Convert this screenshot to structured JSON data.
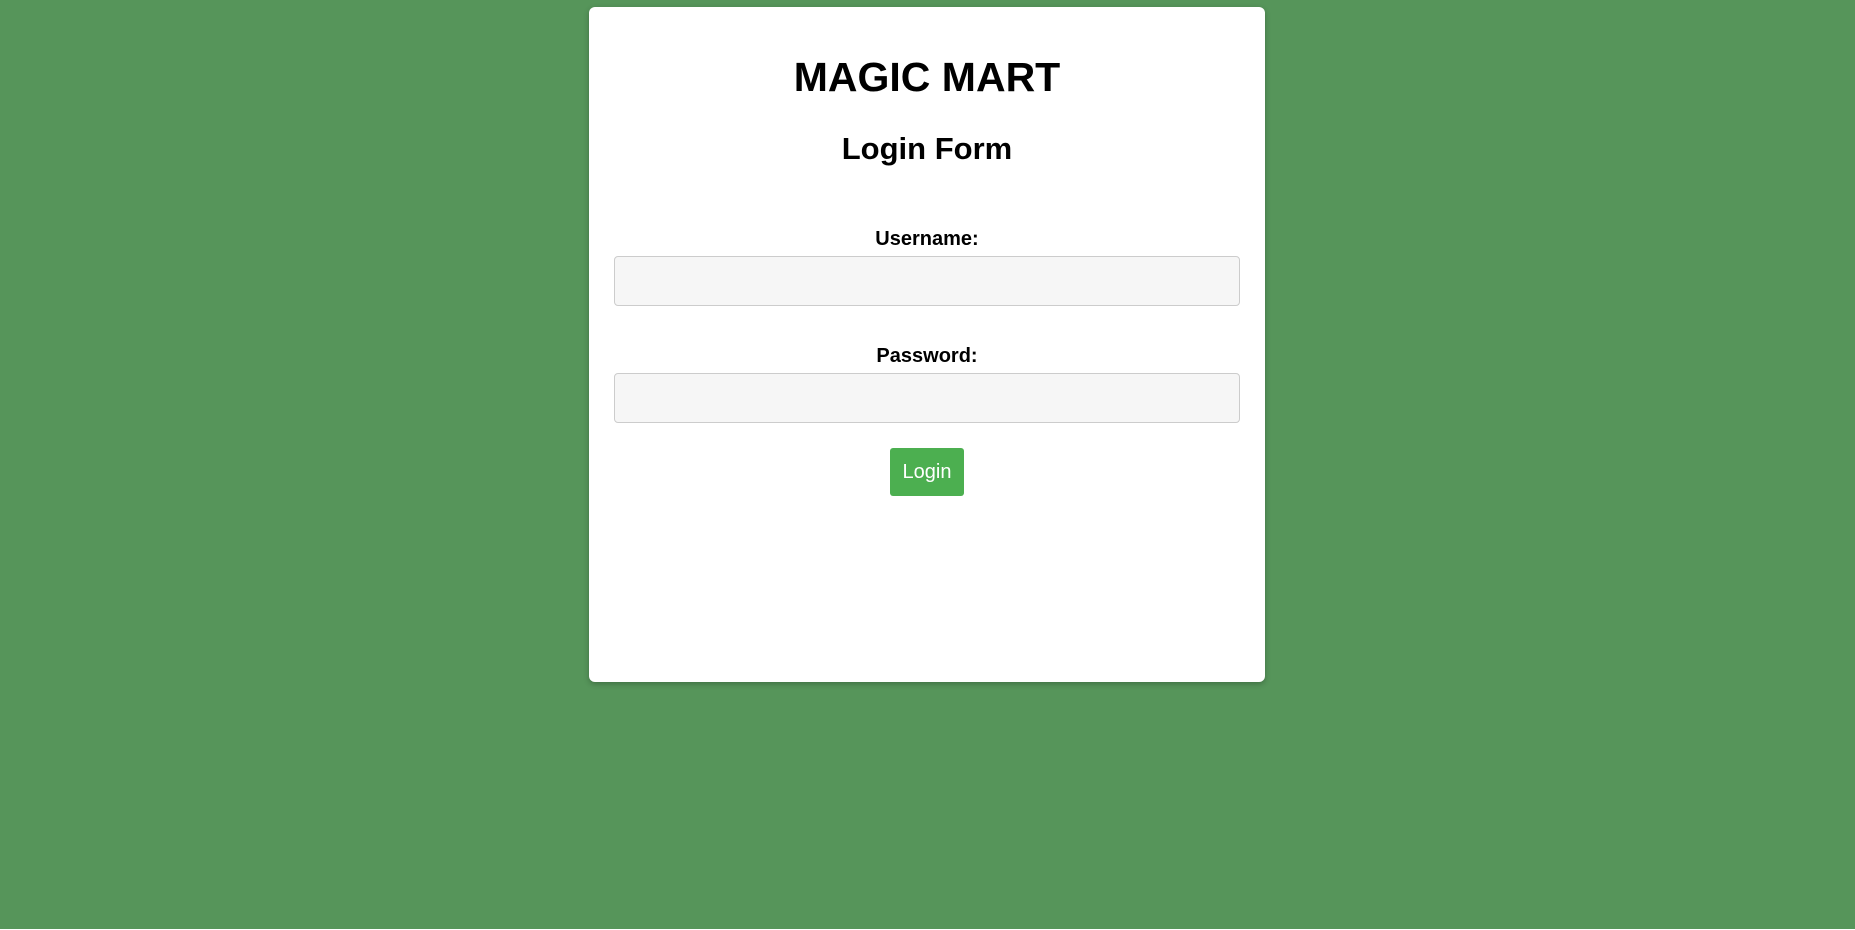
{
  "page": {
    "background_color": "#56955a"
  },
  "card": {
    "brand_title": "MAGIC MART",
    "form_title": "Login Form"
  },
  "form": {
    "username_label": "Username:",
    "username_value": "",
    "password_label": "Password:",
    "password_value": "",
    "login_label": "Login",
    "login_button_color": "#4caf50"
  }
}
